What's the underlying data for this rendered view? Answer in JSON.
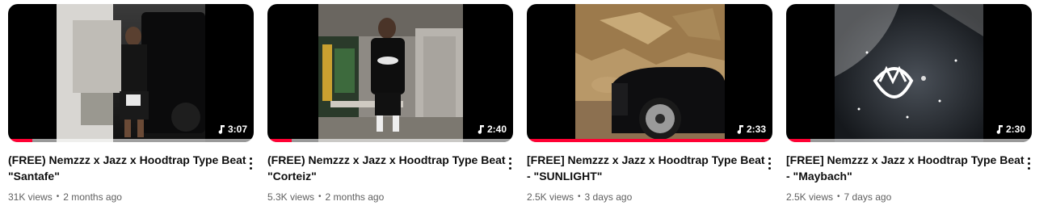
{
  "videos": [
    {
      "title_line1": "(FREE) Nemzzz x Jazz x Hoodtrap Type Beat",
      "title_line2": "\"Santafe\"",
      "views": "31K views",
      "age": "2 months ago",
      "duration": "3:07",
      "progress_fraction": 0.1,
      "thumbnail_icon": "photo-man-by-suv",
      "accent_color": "#ff0033"
    },
    {
      "title_line1": "(FREE) Nemzzz x Jazz x Hoodtrap Type Beat",
      "title_line2": "\"Corteiz\"",
      "views": "5.3K views",
      "age": "2 months ago",
      "duration": "2:40",
      "progress_fraction": 0.1,
      "thumbnail_icon": "photo-man-at-shop",
      "accent_color": "#ff0033"
    },
    {
      "title_line1": "[FREE] Nemzzz x Jazz x Hoodtrap Type Beat",
      "title_line2": "- \"SUNLIGHT\"",
      "views": "2.5K views",
      "age": "3 days ago",
      "duration": "2:33",
      "progress_fraction": 1.0,
      "thumbnail_icon": "photo-car-by-rocks",
      "accent_color": "#ff0033"
    },
    {
      "title_line1": "[FREE] Nemzzz x Jazz x Hoodtrap Type Beat",
      "title_line2": "- \"Maybach\"",
      "views": "2.5K views",
      "age": "7 days ago",
      "duration": "2:30",
      "progress_fraction": 0.1,
      "thumbnail_icon": "photo-maybach-logo",
      "accent_color": "#ff0033"
    }
  ],
  "icons": {
    "duration_icon": "music-note-icon",
    "menu_icon": "more-vert-icon"
  }
}
